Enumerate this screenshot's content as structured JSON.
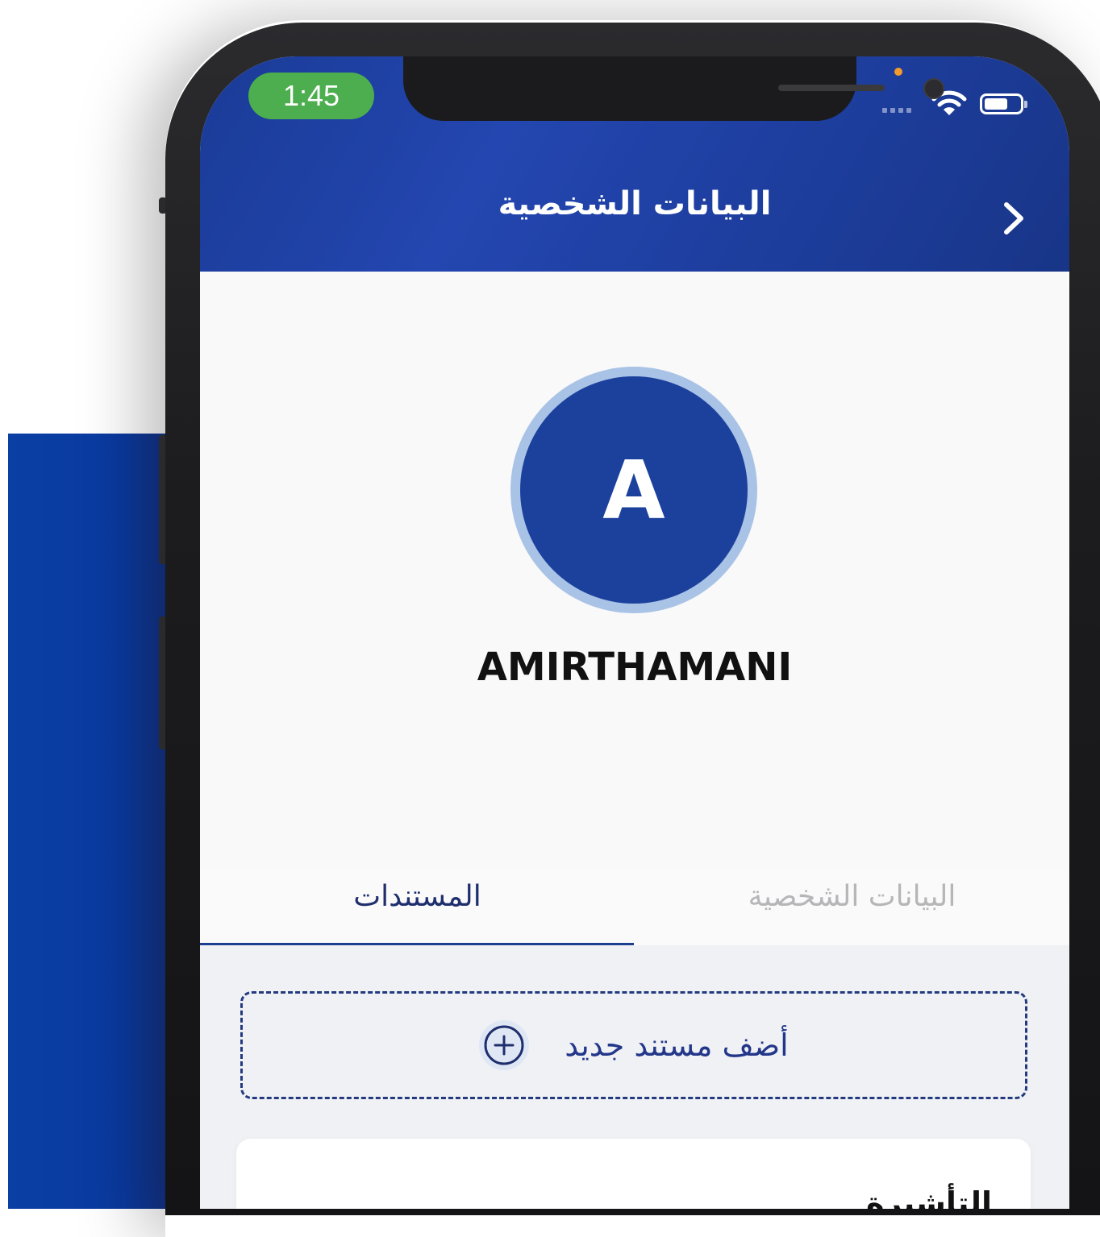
{
  "status_bar": {
    "time": "1:45"
  },
  "header": {
    "title": "البيانات الشخصية"
  },
  "profile": {
    "initial": "A",
    "name": "AMIRTHAMANI"
  },
  "tabs": [
    {
      "label": "المستندات",
      "active": true
    },
    {
      "label": "البيانات الشخصية",
      "active": false
    }
  ],
  "documents": {
    "add_label": "أضف مستند جديد",
    "items": [
      {
        "title": "التأشيرة"
      }
    ]
  },
  "colors": {
    "brand_blue": "#1c419d",
    "status_green": "#4cae4f",
    "accent_orange": "#f39a2d"
  },
  "icons": [
    "chevron-right-icon",
    "wifi-icon",
    "battery-icon",
    "plus-circle-icon"
  ]
}
